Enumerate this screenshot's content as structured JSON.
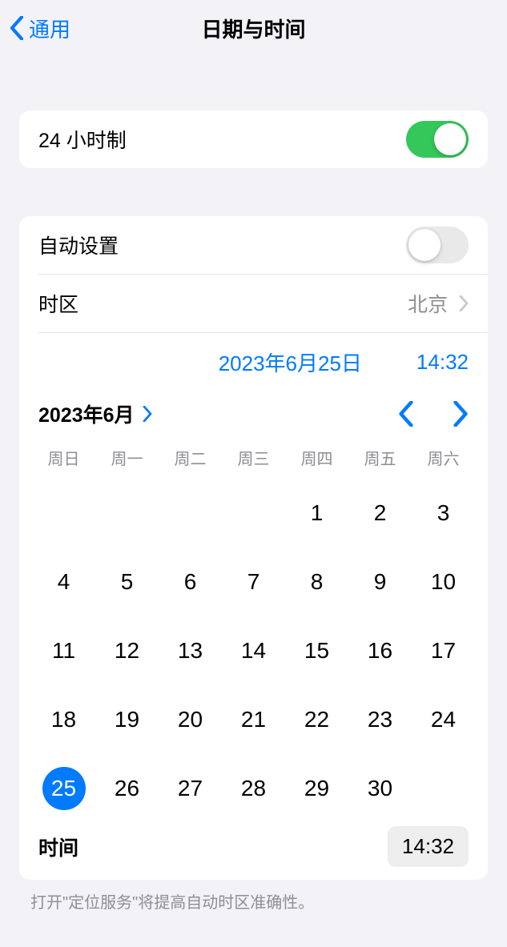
{
  "header": {
    "back_label": "通用",
    "title": "日期与时间"
  },
  "settings": {
    "twenty_four_hour_label": "24 小时制",
    "twenty_four_hour_on": true,
    "auto_set_label": "自动设置",
    "auto_set_on": false,
    "timezone_label": "时区",
    "timezone_value": "北京"
  },
  "datetime": {
    "date_display": "2023年6月25日",
    "time_display": "14:32"
  },
  "calendar": {
    "month_label": "2023年6月",
    "weekdays": [
      "周日",
      "周一",
      "周二",
      "周三",
      "周四",
      "周五",
      "周六"
    ],
    "first_weekday_index": 4,
    "days_in_month": 30,
    "selected_day": 25,
    "time_label": "时间",
    "time_value": "14:32"
  },
  "footnote": "打开\"定位服务\"将提高自动时区准确性。"
}
